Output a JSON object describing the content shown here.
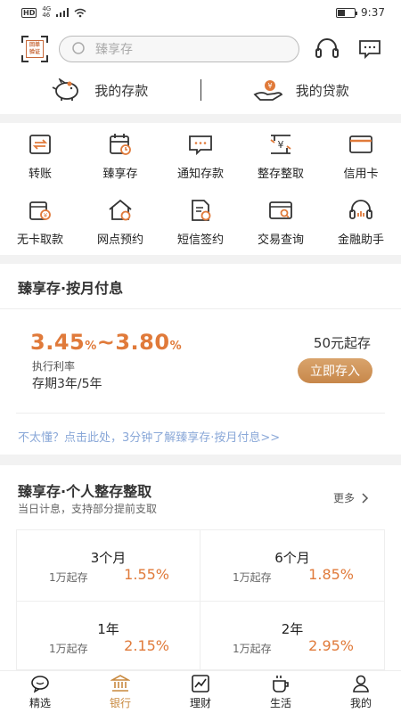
{
  "status": {
    "hd": "HD",
    "net_top": "4G",
    "net_bottom": "46",
    "time": "9:37"
  },
  "header": {
    "scan_label": "回单\n验证",
    "search_placeholder": "臻享存",
    "my_deposit": "我的存款",
    "my_loan": "我的贷款"
  },
  "quick": [
    {
      "label": "转账",
      "icon": "transfer-icon"
    },
    {
      "label": "臻享存",
      "icon": "calendar-icon"
    },
    {
      "label": "通知存款",
      "icon": "message-icon"
    },
    {
      "label": "整存整取",
      "icon": "yuan-exchange-icon"
    },
    {
      "label": "信用卡",
      "icon": "credit-card-icon"
    },
    {
      "label": "无卡取款",
      "icon": "cardless-withdraw-icon"
    },
    {
      "label": "网点预约",
      "icon": "branch-home-icon"
    },
    {
      "label": "短信签约",
      "icon": "sms-sign-icon"
    },
    {
      "label": "交易查询",
      "icon": "transaction-search-icon"
    },
    {
      "label": "金融助手",
      "icon": "headset-icon"
    }
  ],
  "card1": {
    "title": "臻享存·按月付息",
    "rate_low": "3.45",
    "rate_sep": "~",
    "rate_high": "3.80",
    "pct": "%",
    "rate_label": "执行利率",
    "term": "存期3年/5年",
    "min": "50元起存",
    "button": "立即存入",
    "learn": "不太懂？点击此处，3分钟了解臻享存·按月付息>>"
  },
  "card2": {
    "title": "臻享存·个人整存整取",
    "subtitle": "当日计息，支持部分提前支取",
    "more": "更多",
    "terms": [
      {
        "name": "3个月",
        "min": "1万起存",
        "rate": "1.55%"
      },
      {
        "name": "6个月",
        "min": "1万起存",
        "rate": "1.85%"
      },
      {
        "name": "1年",
        "min": "1万起存",
        "rate": "2.15%"
      },
      {
        "name": "2年",
        "min": "1万起存",
        "rate": "2.95%"
      }
    ]
  },
  "tabs": [
    {
      "label": "精选",
      "icon": "chat-bubble-icon"
    },
    {
      "label": "银行",
      "icon": "bank-icon"
    },
    {
      "label": "理财",
      "icon": "chart-icon"
    },
    {
      "label": "生活",
      "icon": "coffee-icon"
    },
    {
      "label": "我的",
      "icon": "person-icon"
    }
  ],
  "colors": {
    "accent": "#e07a3a",
    "button": "#c7874a",
    "link": "#8aa8d8",
    "active_tab": "#c8893f"
  }
}
